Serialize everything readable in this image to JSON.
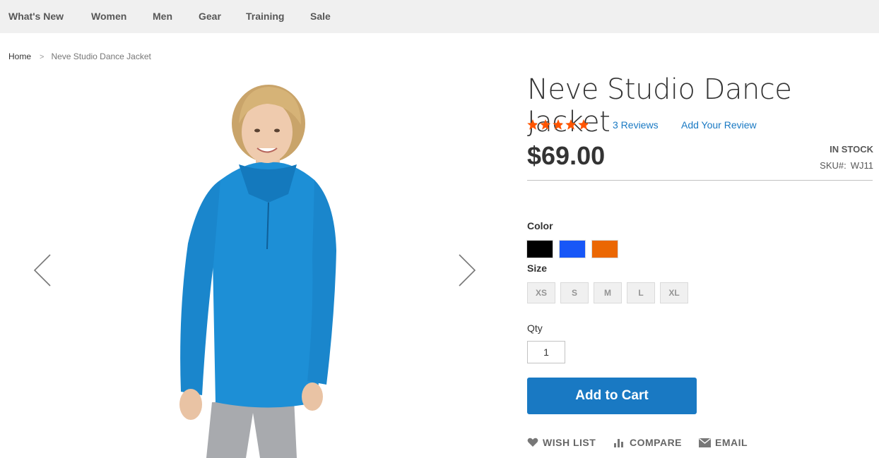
{
  "nav": {
    "items": [
      {
        "label": "What's New"
      },
      {
        "label": "Women"
      },
      {
        "label": "Men"
      },
      {
        "label": "Gear"
      },
      {
        "label": "Training"
      },
      {
        "label": "Sale"
      }
    ]
  },
  "breadcrumb": {
    "home": "Home",
    "separator": ">",
    "current": "Neve Studio Dance Jacket"
  },
  "gallery": {
    "prev_icon": "chevron-left-icon",
    "next_icon": "chevron-right-icon"
  },
  "product": {
    "name": "Neve Studio Dance Jacket",
    "rating_fraction": 0.88,
    "reviews_link": "3 Reviews",
    "add_review_link": "Add Your Review",
    "price": "$69.00",
    "stock": "IN STOCK",
    "sku_label": "SKU#:",
    "sku": "WJ11"
  },
  "options": {
    "color_label": "Color",
    "colors": [
      "#000000",
      "#1857f7",
      "#eb6703"
    ],
    "size_label": "Size",
    "sizes": [
      "XS",
      "S",
      "M",
      "L",
      "XL"
    ]
  },
  "qty": {
    "label": "Qty",
    "value": "1"
  },
  "actions": {
    "add_to_cart": "Add to Cart",
    "wish_list": "WISH LIST",
    "compare": "COMPARE",
    "email": "EMAIL"
  },
  "colors": {
    "accent": "#1979c3",
    "star": "#ff5501",
    "nav_bg": "#f0f0f0"
  }
}
